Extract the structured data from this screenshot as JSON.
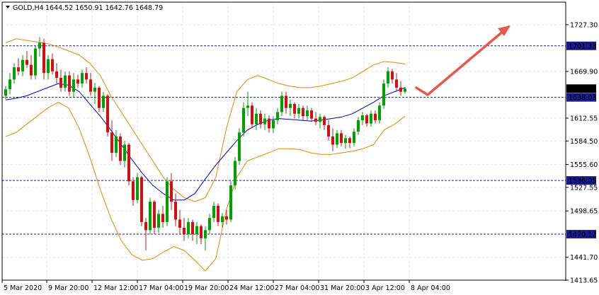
{
  "header": {
    "symbol": "GOLD,H4",
    "ohlc": "1644.52 1650.91 1642.76 1648.79"
  },
  "colors": {
    "bull": "#00a000",
    "bear": "#d01010",
    "upper_band": "#e08a00",
    "lower_band": "#e08a00",
    "ma": "#0000c0",
    "levels": "#1a1a8c",
    "price_label_bg": "#000000",
    "level_label_bg": "#1a1a8c",
    "arrow": "#e8574a",
    "grid": "#e6e6e6"
  },
  "chart_data": {
    "type": "candlestick",
    "title": "GOLD,H4",
    "ylim": [
      1413.65,
      1755.0
    ],
    "y_ticks": [
      "1727.30",
      "1669.90",
      "1612.55",
      "1584.50",
      "1555.60",
      "1527.55",
      "1498.65",
      "1441.70",
      "1413.65"
    ],
    "x_ticks": [
      "5 Mar 2020",
      "9 Mar 20:00",
      "12 Mar 12:00",
      "17 Mar 04:00",
      "19 Mar 20:00",
      "24 Mar 12:00",
      "27 Mar 04:00",
      "31 Mar 20:00",
      "3 Apr 12:00",
      "8 Apr 04:00"
    ],
    "current_price": "1648.79",
    "levels": [
      {
        "value": 1701.33,
        "label": "1701.33"
      },
      {
        "value": 1638.03,
        "label": "1638.03"
      },
      {
        "value": 1536.05,
        "label": "1536.05"
      },
      {
        "value": 1470.12,
        "label": "1470.12"
      }
    ],
    "candles": [
      [
        1640,
        1652,
        1636,
        1648
      ],
      [
        1648,
        1668,
        1642,
        1660
      ],
      [
        1660,
        1680,
        1655,
        1675
      ],
      [
        1675,
        1686,
        1665,
        1670
      ],
      [
        1670,
        1690,
        1664,
        1684
      ],
      [
        1684,
        1695,
        1674,
        1678
      ],
      [
        1678,
        1690,
        1660,
        1665
      ],
      [
        1665,
        1702,
        1660,
        1698
      ],
      [
        1698,
        1712,
        1688,
        1705
      ],
      [
        1705,
        1710,
        1660,
        1668
      ],
      [
        1668,
        1690,
        1660,
        1685
      ],
      [
        1685,
        1692,
        1666,
        1670
      ],
      [
        1670,
        1680,
        1655,
        1662
      ],
      [
        1662,
        1672,
        1645,
        1650
      ],
      [
        1650,
        1670,
        1645,
        1665
      ],
      [
        1665,
        1670,
        1640,
        1645
      ],
      [
        1645,
        1668,
        1638,
        1660
      ],
      [
        1660,
        1666,
        1650,
        1655
      ],
      [
        1655,
        1672,
        1650,
        1668
      ],
      [
        1668,
        1675,
        1655,
        1660
      ],
      [
        1660,
        1668,
        1640,
        1645
      ],
      [
        1645,
        1656,
        1630,
        1650
      ],
      [
        1650,
        1652,
        1620,
        1625
      ],
      [
        1625,
        1645,
        1620,
        1640
      ],
      [
        1640,
        1642,
        1590,
        1595
      ],
      [
        1595,
        1610,
        1560,
        1570
      ],
      [
        1570,
        1598,
        1565,
        1590
      ],
      [
        1590,
        1594,
        1555,
        1560
      ],
      [
        1560,
        1585,
        1552,
        1580
      ],
      [
        1580,
        1582,
        1530,
        1535
      ],
      [
        1535,
        1540,
        1505,
        1512
      ],
      [
        1512,
        1545,
        1508,
        1540
      ],
      [
        1540,
        1542,
        1480,
        1485
      ],
      [
        1485,
        1490,
        1450,
        1475
      ],
      [
        1475,
        1515,
        1470,
        1510
      ],
      [
        1510,
        1512,
        1470,
        1478
      ],
      [
        1478,
        1500,
        1472,
        1495
      ],
      [
        1495,
        1505,
        1478,
        1485
      ],
      [
        1485,
        1540,
        1480,
        1535
      ],
      [
        1535,
        1545,
        1500,
        1510
      ],
      [
        1510,
        1520,
        1480,
        1488
      ],
      [
        1488,
        1500,
        1470,
        1478
      ],
      [
        1478,
        1490,
        1462,
        1470
      ],
      [
        1470,
        1490,
        1465,
        1485
      ],
      [
        1485,
        1488,
        1462,
        1470
      ],
      [
        1470,
        1485,
        1458,
        1480
      ],
      [
        1480,
        1482,
        1458,
        1465
      ],
      [
        1465,
        1480,
        1450,
        1475
      ],
      [
        1475,
        1495,
        1470,
        1490
      ],
      [
        1490,
        1510,
        1485,
        1505
      ],
      [
        1505,
        1508,
        1480,
        1485
      ],
      [
        1485,
        1496,
        1478,
        1492
      ],
      [
        1492,
        1500,
        1482,
        1488
      ],
      [
        1488,
        1535,
        1485,
        1530
      ],
      [
        1530,
        1565,
        1525,
        1560
      ],
      [
        1560,
        1600,
        1555,
        1595
      ],
      [
        1595,
        1632,
        1590,
        1625
      ],
      [
        1625,
        1645,
        1615,
        1628
      ],
      [
        1628,
        1632,
        1600,
        1605
      ],
      [
        1605,
        1625,
        1598,
        1618
      ],
      [
        1618,
        1622,
        1600,
        1605
      ],
      [
        1605,
        1618,
        1598,
        1612
      ],
      [
        1612,
        1616,
        1595,
        1600
      ],
      [
        1600,
        1615,
        1594,
        1610
      ],
      [
        1610,
        1625,
        1605,
        1620
      ],
      [
        1620,
        1645,
        1615,
        1640
      ],
      [
        1640,
        1645,
        1618,
        1625
      ],
      [
        1625,
        1635,
        1615,
        1630
      ],
      [
        1630,
        1632,
        1612,
        1618
      ],
      [
        1618,
        1630,
        1612,
        1625
      ],
      [
        1625,
        1628,
        1610,
        1615
      ],
      [
        1615,
        1628,
        1610,
        1622
      ],
      [
        1622,
        1625,
        1608,
        1612
      ],
      [
        1612,
        1620,
        1604,
        1608
      ],
      [
        1608,
        1618,
        1600,
        1614
      ],
      [
        1614,
        1616,
        1598,
        1604
      ],
      [
        1604,
        1610,
        1585,
        1590
      ],
      [
        1590,
        1600,
        1572,
        1580
      ],
      [
        1580,
        1598,
        1576,
        1594
      ],
      [
        1594,
        1598,
        1578,
        1582
      ],
      [
        1582,
        1592,
        1575,
        1588
      ],
      [
        1588,
        1590,
        1576,
        1582
      ],
      [
        1582,
        1600,
        1578,
        1596
      ],
      [
        1596,
        1614,
        1592,
        1610
      ],
      [
        1610,
        1620,
        1604,
        1616
      ],
      [
        1616,
        1618,
        1602,
        1606
      ],
      [
        1606,
        1622,
        1602,
        1618
      ],
      [
        1618,
        1622,
        1606,
        1610
      ],
      [
        1610,
        1632,
        1606,
        1628
      ],
      [
        1628,
        1660,
        1624,
        1655
      ],
      [
        1655,
        1675,
        1650,
        1670
      ],
      [
        1670,
        1673,
        1655,
        1660
      ],
      [
        1660,
        1668,
        1645,
        1650
      ],
      [
        1650,
        1658,
        1640,
        1645
      ],
      [
        1645,
        1650.91,
        1642.76,
        1648.79
      ]
    ],
    "series": [
      {
        "values": [
          1705,
          1710,
          1708,
          1706,
          1704,
          1700,
          1695,
          1690,
          1680,
          1665,
          1640,
          1620,
          1600,
          1580,
          1560,
          1540,
          1525,
          1515,
          1510,
          1515,
          1540,
          1600,
          1645,
          1660,
          1665,
          1660,
          1655,
          1652,
          1650,
          1650,
          1652,
          1655,
          1658,
          1662,
          1670,
          1678,
          1682,
          1681,
          1679
        ]
      },
      {
        "values": [
          1635,
          1637,
          1640,
          1645,
          1650,
          1655,
          1653,
          1645,
          1630,
          1615,
          1598,
          1580,
          1562,
          1545,
          1530,
          1520,
          1512,
          1512,
          1520,
          1538,
          1555,
          1570,
          1585,
          1598,
          1605,
          1610,
          1612,
          1611,
          1610,
          1609,
          1610,
          1612,
          1614,
          1618,
          1625,
          1632,
          1640,
          1645,
          1650
        ]
      },
      {
        "values": [
          1590,
          1595,
          1605,
          1615,
          1625,
          1632,
          1625,
          1600,
          1565,
          1525,
          1490,
          1462,
          1445,
          1438,
          1440,
          1448,
          1455,
          1450,
          1438,
          1425,
          1440,
          1500,
          1540,
          1560,
          1565,
          1570,
          1575,
          1575,
          1574,
          1570,
          1568,
          1568,
          1570,
          1572,
          1575,
          1580,
          1598,
          1605,
          1615
        ]
      }
    ]
  }
}
